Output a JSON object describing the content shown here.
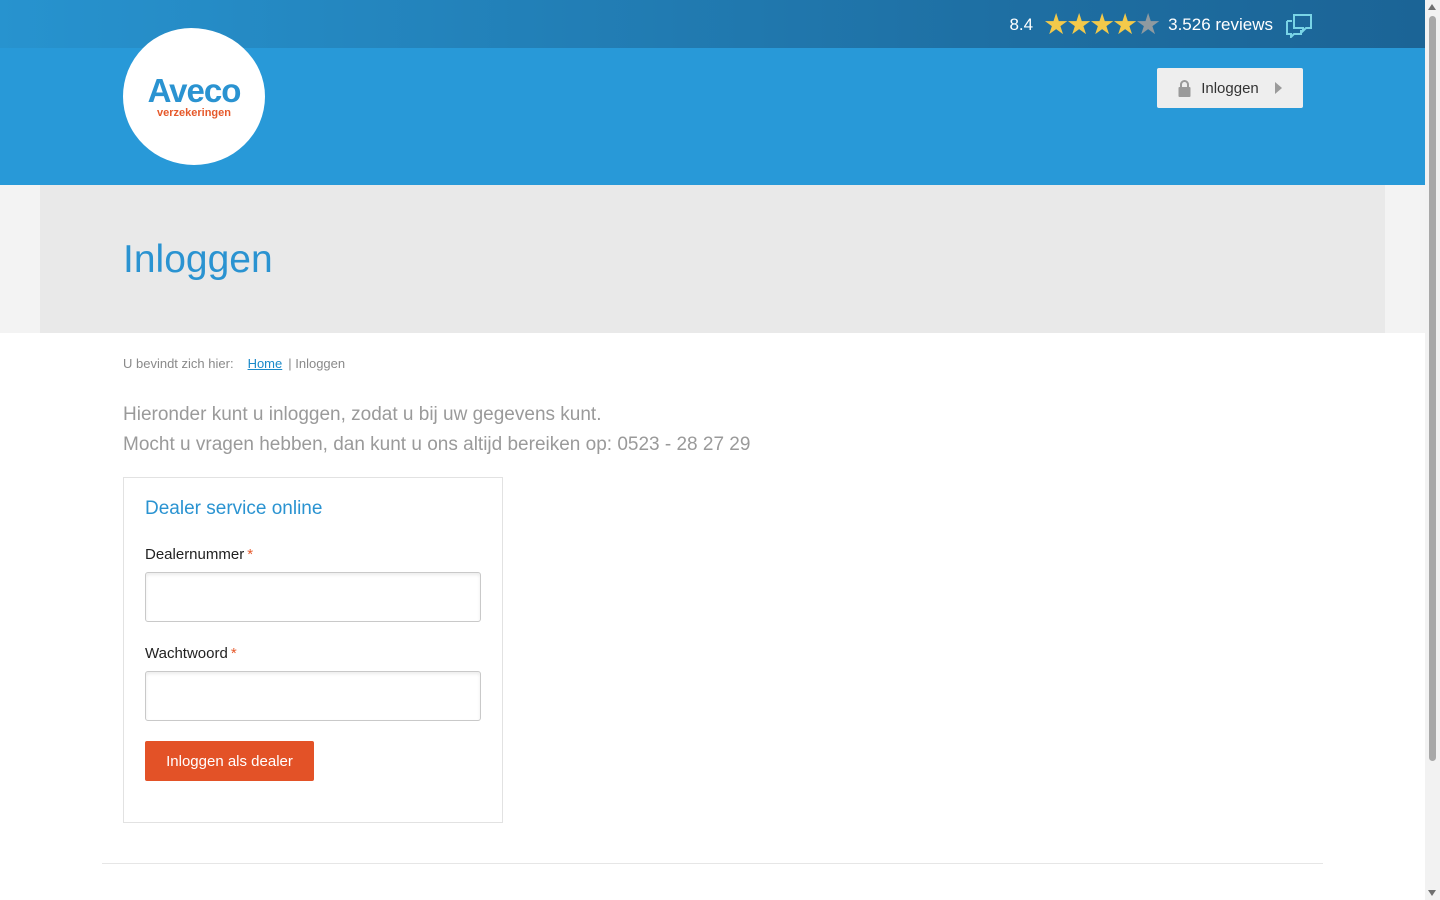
{
  "header": {
    "rating_score": "8.4",
    "stars_filled": 4,
    "stars_total": 5,
    "reviews_text": "3.526 reviews",
    "logo_main": "Aveco",
    "logo_sub": "verzekeringen",
    "login_button_label": "Inloggen"
  },
  "hero": {
    "title": "Inloggen"
  },
  "breadcrumb": {
    "prefix": "U bevindt zich hier:",
    "home_label": "Home",
    "current": "| Inloggen"
  },
  "intro": {
    "line1": "Hieronder kunt u inloggen, zodat u bij uw gegevens kunt.",
    "line2": "Mocht u vragen hebben, dan kunt u ons altijd bereiken op: 0523 - 28 27 29"
  },
  "login_form": {
    "title": "Dealer service online",
    "dealer_number_label": "Dealernummer",
    "password_label": "Wachtwoord",
    "required_marker": "*",
    "submit_label": "Inloggen als dealer",
    "dealer_number_value": "",
    "password_value": ""
  },
  "colors": {
    "brand_blue": "#2899d8",
    "accent_orange": "#e35227",
    "star_gold": "#f3c94a"
  }
}
